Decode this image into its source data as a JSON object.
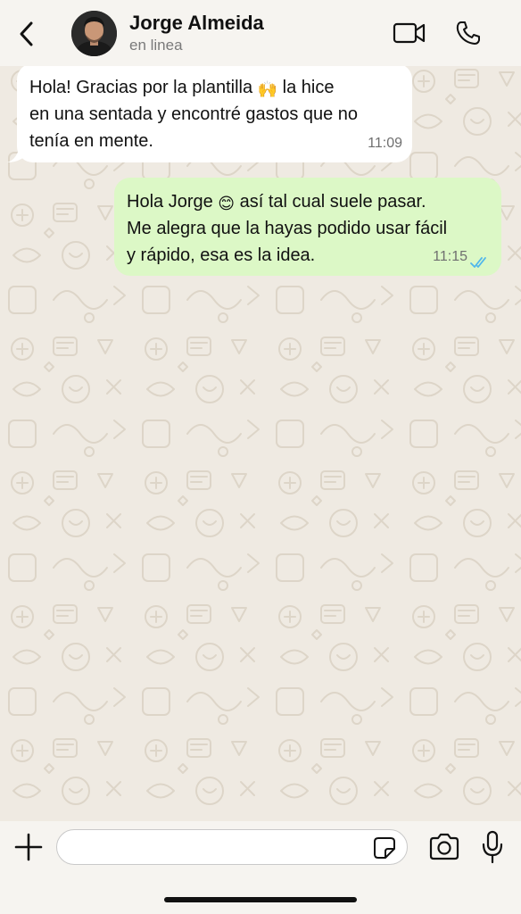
{
  "contact": {
    "name": "Jorge Almeida",
    "status": "en linea"
  },
  "messages": [
    {
      "direction": "incoming",
      "line1_a": "Hola! Gracias por la plantilla ",
      "line1_emoji": "🙌",
      "line1_b": " la hice",
      "line2": "en una sentada y encontré gastos que no",
      "line3": "tenía en mente.",
      "time": "11:09"
    },
    {
      "direction": "outgoing",
      "line1_a": "Hola Jorge ",
      "line1_emoji": "😊",
      "line1_b": " así tal cual suele pasar.",
      "line2": "Me alegra que la hayas podido usar fácil",
      "line3": "y rápido, esa es la idea.",
      "time": "11:15",
      "status": "read"
    }
  ],
  "composer": {
    "value": "",
    "placeholder": ""
  },
  "icons": {
    "back": "chevron-left-icon",
    "video": "video-camera-icon",
    "call": "phone-icon",
    "attach": "plus-icon",
    "sticker": "sticker-icon",
    "camera": "camera-icon",
    "mic": "microphone-icon",
    "read_ticks": "double-check-icon"
  },
  "colors": {
    "header_bg": "#f6f4f0",
    "chat_bg": "#efeae2",
    "incoming_bubble": "#ffffff",
    "outgoing_bubble": "#dcf8c6",
    "read_tick": "#4fb6ec"
  }
}
